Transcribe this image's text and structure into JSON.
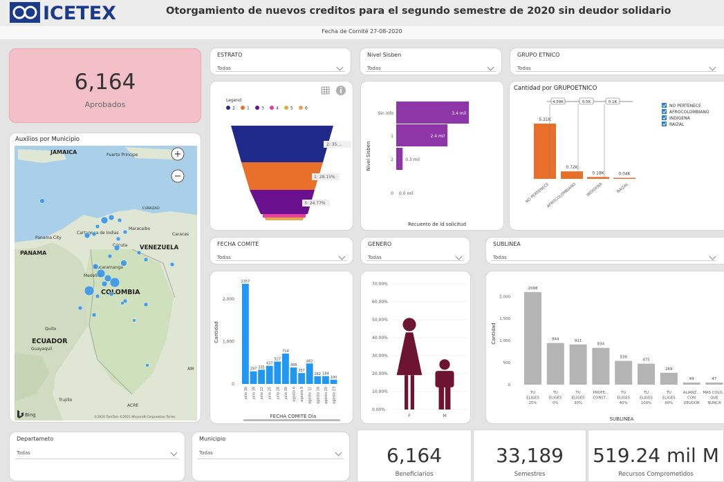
{
  "header": {
    "logo_text": "ICETEX",
    "title": "Otorgamiento de nuevos creditos para el segundo semestre de 2020 sin deudor solidario",
    "subtitle": "Fecha de Comité 27-08-2020"
  },
  "kpis": {
    "aprobados": {
      "value": "6,164",
      "label": "Aprobados"
    },
    "beneficiarios": {
      "value": "6,164",
      "label": "Beneficiarios"
    },
    "semestres": {
      "value": "33,189",
      "label": "Semestres"
    },
    "recursos": {
      "value": "519.24 mil M",
      "label": "Recursos Comprometidos"
    }
  },
  "slicers": {
    "estrato": {
      "title": "ESTRATO",
      "value": "Todas"
    },
    "sisben": {
      "title": "Nivel Sisben",
      "value": "Todas"
    },
    "grupo": {
      "title": "GRUPO ETNICO",
      "value": "Todas"
    },
    "fecha": {
      "title": "FECHA COMITÉ",
      "value": "Todas"
    },
    "genero": {
      "title": "GENERO",
      "value": "Todas"
    },
    "sublinea": {
      "title": "SUBLINEA",
      "value": "Todas"
    },
    "departamento": {
      "title": "Departameto",
      "value": "Todas"
    },
    "municipio": {
      "title": "Municipio",
      "value": "Todas"
    }
  },
  "map": {
    "title": "Auxilios por Municipio",
    "labels": {
      "jamaica": "JAMAICA",
      "puerto": "Puerto Principe",
      "panama": "PANAMA",
      "panama_city": "Panama City",
      "venezuela": "VENEZUELA",
      "colombia": "COLOMBIA",
      "ecuador": "ECUADOR",
      "cartagena": "Cartagena de Indias",
      "bucaramanga": "Bucaramanga",
      "medellin": "Medellin",
      "cucuta": "Cúcuta",
      "maracaibo": "Maracaibo",
      "caracas": "Caracas",
      "curazao": "CURAZAO",
      "quito": "Quito",
      "guayaquil": "Guayaquil",
      "trujillo": "Trujillo",
      "acre": "ACRE",
      "aam": "AM"
    },
    "bing": "Bing",
    "copyright": "©2020 TomTom ©2021 Microsoft Corporation Terms",
    "zoom_in": "+",
    "zoom_out": "−"
  },
  "colors": {
    "purple": "#8e36a8",
    "orange": "#e8702a",
    "blue": "#2196f3",
    "gray": "#b4b4b4",
    "maroon": "#6e1433",
    "pink": "#f4c0c8",
    "navy": "#1f2a8a"
  },
  "funnel": {
    "legend_title": "Legend",
    "legend": [
      {
        "name": "2",
        "color": "#1f2a8a"
      },
      {
        "name": "1",
        "color": "#e8702a"
      },
      {
        "name": "3",
        "color": "#6a0f8e"
      },
      {
        "name": "4",
        "color": "#e43fa0"
      },
      {
        "name": "5",
        "color": "#d8b33a"
      },
      {
        "name": "6",
        "color": "#f0a050"
      }
    ],
    "labels": [
      "2: 35...",
      "1: 28.15%",
      "3: 24.77%"
    ]
  },
  "chart_data": [
    {
      "type": "bar",
      "orientation": "horizontal",
      "categories": [
        "Sin info",
        "1",
        "2",
        "0"
      ],
      "values": [
        3400,
        2400,
        300,
        0
      ],
      "value_labels": [
        "3.4 mil",
        "2.4 mil",
        "0.3 mil",
        "0.0 mil"
      ],
      "xlabel": "Recuento de Id solicitud",
      "ylabel": "Nivel Sisben"
    },
    {
      "type": "bar",
      "title": "Cantidad por GRUPOETNICO",
      "categories": [
        "NO PERTENECE",
        "AFROCOLOMBIANO",
        "INDIGENA",
        "RAIZAL"
      ],
      "values": [
        5310,
        720,
        180,
        40
      ],
      "value_labels": [
        "5.31K",
        "0.72K",
        "0.18K",
        "0.04K"
      ],
      "flags": [
        "4.59K",
        "0.5K",
        "0.1K"
      ],
      "legend": [
        "NO PERTENECE",
        "AFROCOLOMBIANO",
        "INDIGENA",
        "RAIZAL"
      ]
    },
    {
      "type": "bar",
      "categories": [
        "julio 16",
        "julio 19",
        "julio 22",
        "julio 25",
        "julio 28",
        "julio 30",
        "agosto 6",
        "agosto 9",
        "agosto 12",
        "agosto 16",
        "agosto 20",
        "agosto 23"
      ],
      "values": [
        2357,
        297,
        335,
        427,
        527,
        714,
        388,
        257,
        482,
        182,
        184,
        100
      ],
      "xlabel": "FECHA COMITÉ Día",
      "ylabel": "Cantidad",
      "yticks": [
        "0",
        "1,000",
        "2,000"
      ]
    },
    {
      "type": "bar",
      "categories": [
        "F",
        "M"
      ],
      "values": [
        51,
        28
      ],
      "yticks": [
        "0.00%",
        "10.00%",
        "20.00%",
        "30.00%",
        "40.00%",
        "50.00%",
        "60.00%",
        "70.00%"
      ]
    },
    {
      "type": "bar",
      "categories": [
        "TU ELIGES 25%",
        "TU ELIGES 0%",
        "TU ELIGES 30%",
        "PROFE... CONST...",
        "TU ELIGES 40%",
        "TU ELIGES 100%",
        "TU ELIGES 60%",
        "ALIANZ... CON DEUDOR",
        "MAS COLO... QUE NUNCA"
      ],
      "values": [
        2098,
        944,
        911,
        834,
        539,
        475,
        269,
        49,
        47
      ],
      "xlabel": "SUBLINEA",
      "ylabel": "Cantidad",
      "yticks": [
        "0",
        "500",
        "1,000",
        "1,500",
        "2,000"
      ]
    }
  ]
}
